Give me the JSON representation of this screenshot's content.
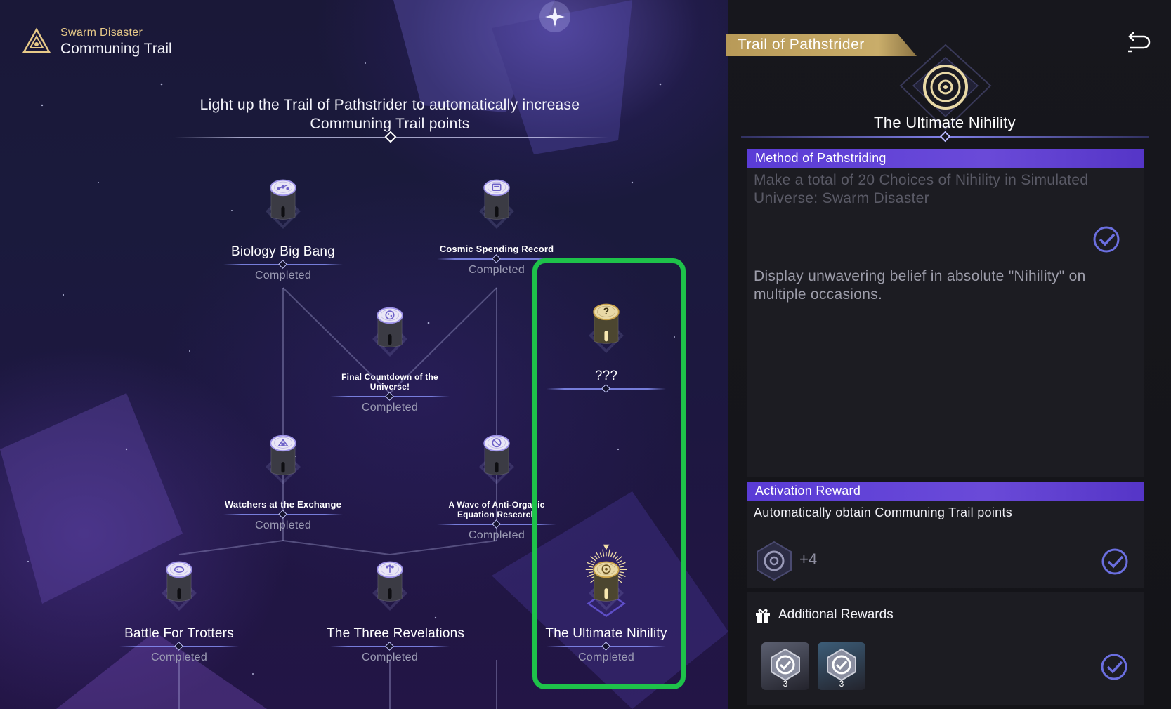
{
  "header": {
    "subtitle": "Swarm Disaster",
    "title": "Communing Trail",
    "icon": "triangle-emblem-icon"
  },
  "intro_text": "Light up the Trail of Pathstrider to automatically increase Communing Trail points",
  "nodes": [
    {
      "id": "biology-big-bang",
      "label": "Biology Big Bang",
      "status": "Completed",
      "icon": "molecule-icon"
    },
    {
      "id": "cosmic-spending-record",
      "label": "Cosmic Spending Record",
      "status": "Completed",
      "icon": "receipt-icon"
    },
    {
      "id": "final-countdown",
      "label": "Final Countdown of the Universe!",
      "status": "Completed",
      "icon": "galaxy-icon"
    },
    {
      "id": "unknown",
      "label": "???",
      "status": "",
      "icon": "question-icon"
    },
    {
      "id": "watchers-exchange",
      "label": "Watchers at the Exchange",
      "status": "Completed",
      "icon": "building-icon"
    },
    {
      "id": "anti-organic",
      "label": "A Wave of Anti-Organic Equation Research",
      "status": "Completed",
      "icon": "no-entry-icon"
    },
    {
      "id": "battle-trotters",
      "label": "Battle For Trotters",
      "status": "Completed",
      "icon": "trotter-icon"
    },
    {
      "id": "three-revelations",
      "label": "The Three Revelations",
      "status": "Completed",
      "icon": "trident-icon"
    },
    {
      "id": "ultimate-nihility",
      "label": "The Ultimate Nihility",
      "status": "Completed",
      "icon": "nihility-icon"
    }
  ],
  "panel": {
    "tag": "Trail of Pathstrider",
    "title": "The Ultimate Nihility",
    "method_heading": "Method of Pathstriding",
    "method_text": "Make a total of 20 Choices of Nihility in Simulated Universe: Swarm Disaster",
    "flavor_text": "Display unwavering belief in absolute \"Nihility\" on multiple occasions.",
    "activation_heading": "Activation Reward",
    "activation_text": "Automatically obtain Communing Trail points",
    "points": "+4",
    "additional_heading": "Additional Rewards",
    "items": [
      {
        "name": "reward-item-1",
        "count": "3",
        "color": "#5b5f70"
      },
      {
        "name": "reward-item-2",
        "count": "3",
        "color": "#3c5d78"
      }
    ]
  },
  "colors": {
    "accent_gold": "#c9ad6a",
    "section_purple": "#5a3cd6",
    "highlight_green": "#1ec24a"
  }
}
